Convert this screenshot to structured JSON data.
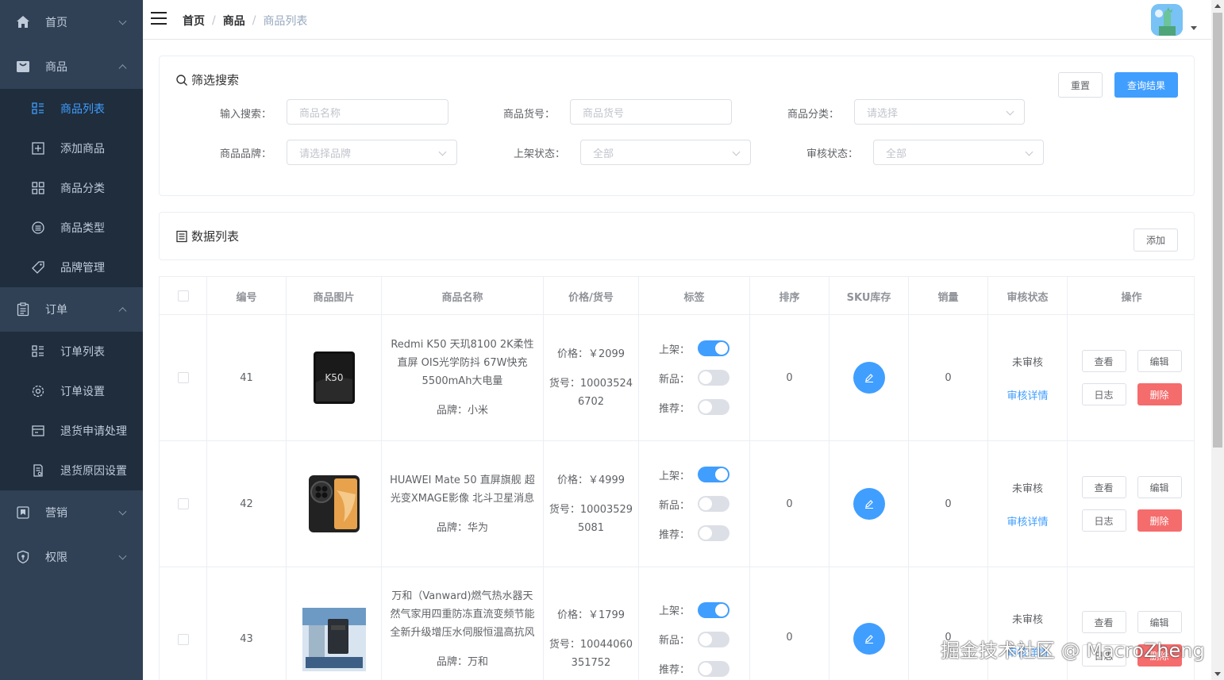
{
  "sidebar": {
    "menus": [
      {
        "label": "首页",
        "icon": "home-icon",
        "expanded": false
      },
      {
        "label": "商品",
        "icon": "shopping-bag-icon",
        "expanded": true,
        "items": [
          {
            "label": "商品列表",
            "icon": "list-icon",
            "active": true
          },
          {
            "label": "添加商品",
            "icon": "add-box-icon"
          },
          {
            "label": "商品分类",
            "icon": "grid-icon"
          },
          {
            "label": "商品类型",
            "icon": "type-icon"
          },
          {
            "label": "品牌管理",
            "icon": "tag-icon"
          }
        ]
      },
      {
        "label": "订单",
        "icon": "clipboard-icon",
        "expanded": true,
        "items": [
          {
            "label": "订单列表",
            "icon": "list-icon"
          },
          {
            "label": "订单设置",
            "icon": "settings-icon"
          },
          {
            "label": "退货申请处理",
            "icon": "return-icon"
          },
          {
            "label": "退货原因设置",
            "icon": "document-settings-icon"
          }
        ]
      },
      {
        "label": "营销",
        "icon": "marketing-icon",
        "expanded": false
      },
      {
        "label": "权限",
        "icon": "shield-icon",
        "expanded": false
      }
    ]
  },
  "navbar": {
    "breadcrumb": [
      "首页",
      "商品",
      "商品列表"
    ]
  },
  "filter": {
    "title": "筛选搜索",
    "reset_label": "重置",
    "query_label": "查询结果",
    "fields": [
      {
        "label": "输入搜索：",
        "placeholder": "商品名称",
        "type": "input"
      },
      {
        "label": "商品货号：",
        "placeholder": "商品货号",
        "type": "input"
      },
      {
        "label": "商品分类：",
        "placeholder": "请选择",
        "type": "select"
      },
      {
        "label": "商品品牌：",
        "placeholder": "请选择品牌",
        "type": "select"
      },
      {
        "label": "上架状态：",
        "placeholder": "全部",
        "type": "select"
      },
      {
        "label": "审核状态：",
        "placeholder": "全部",
        "type": "select"
      }
    ]
  },
  "data_list": {
    "title": "数据列表",
    "add_label": "添加"
  },
  "table": {
    "headers": [
      "编号",
      "商品图片",
      "商品名称",
      "价格/货号",
      "标签",
      "排序",
      "SKU库存",
      "销量",
      "审核状态",
      "操作"
    ],
    "tag_labels": [
      "上架：",
      "新品：",
      "推荐："
    ],
    "rows": [
      {
        "id": "41",
        "name": "Redmi K50 天玑8100 2K柔性直屏 OIS光学防抖 67W快充 5500mAh大电量",
        "brand": "品牌：小米",
        "price": "价格：￥2099",
        "sku": "货号：100035246702",
        "publish": true,
        "new": false,
        "recommend": false,
        "sort": "0",
        "sales": "0",
        "audit": "未审核",
        "audit_link": "审核详情"
      },
      {
        "id": "42",
        "name": "HUAWEI Mate 50 直屏旗舰 超光变XMAGE影像 北斗卫星消息",
        "brand": "品牌：华为",
        "price": "价格：￥4999",
        "sku": "货号：100035295081",
        "publish": true,
        "new": false,
        "recommend": false,
        "sort": "0",
        "sales": "0",
        "audit": "未审核",
        "audit_link": "审核详情"
      },
      {
        "id": "43",
        "name": "万和（Vanward)燃气热水器天然气家用四重防冻直流变频节能全新升级增压水伺服恒温高抗风",
        "brand": "品牌：万和",
        "price": "价格：￥1799",
        "sku": "货号：10044060351752",
        "publish": true,
        "new": false,
        "recommend": false,
        "sort": "0",
        "sales": "0",
        "audit": "未审核",
        "audit_link": "审核详情"
      }
    ],
    "op_labels": {
      "view": "查看",
      "edit": "编辑",
      "log": "日志",
      "delete": "删除"
    }
  },
  "watermark": "掘金技术社区 @ MacroZheng",
  "colors": {
    "sidebar": "#304156",
    "submenu": "#1f2d3d",
    "primary": "#409eff",
    "danger": "#f56c6c"
  }
}
